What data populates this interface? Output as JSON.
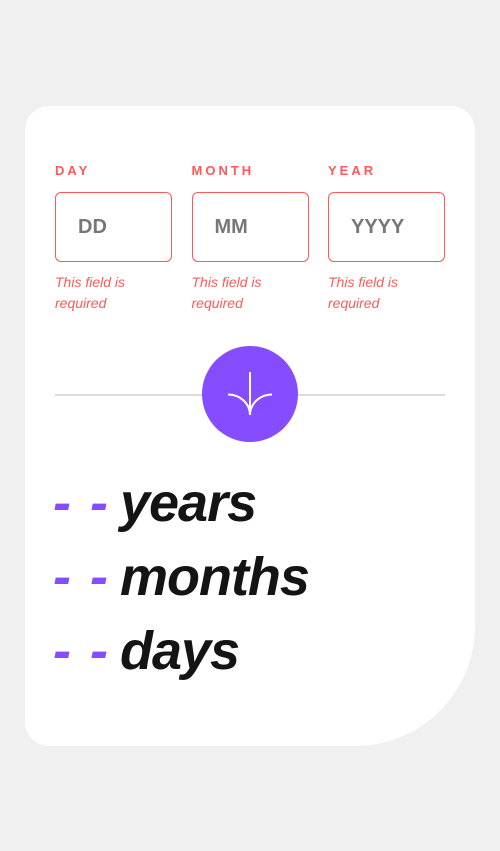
{
  "form": {
    "day": {
      "label": "DAY",
      "placeholder": "DD",
      "value": "",
      "error": "This field is required"
    },
    "month": {
      "label": "MONTH",
      "placeholder": "MM",
      "value": "",
      "error": "This field is required"
    },
    "year": {
      "label": "YEAR",
      "placeholder": "YYYY",
      "value": "",
      "error": "This field is required"
    }
  },
  "submit": {
    "icon": "arrow-down-icon"
  },
  "results": {
    "years": {
      "value": "- -",
      "unit": "years"
    },
    "months": {
      "value": "- -",
      "unit": "months"
    },
    "days": {
      "value": "- -",
      "unit": "days"
    }
  },
  "colors": {
    "accent": "#854dff",
    "error": "#ff5959",
    "text": "#141414",
    "background": "#f0f0f0",
    "card": "#ffffff"
  }
}
